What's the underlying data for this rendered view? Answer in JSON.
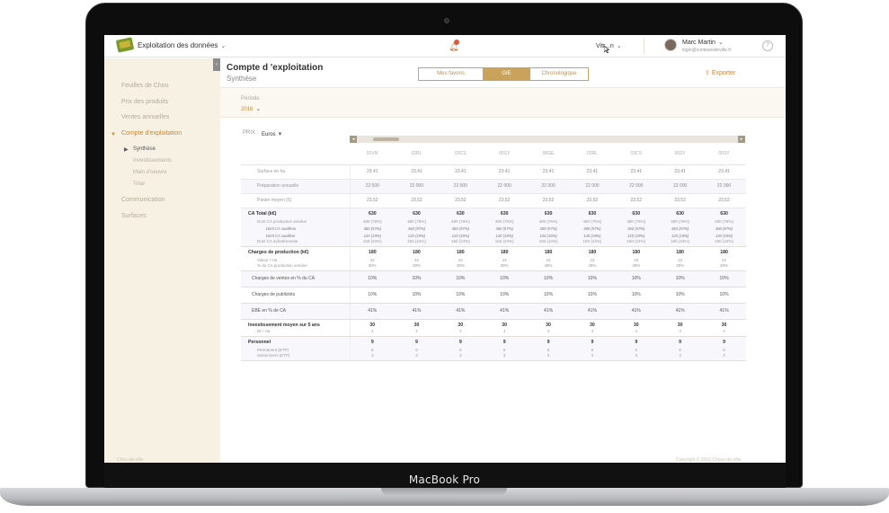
{
  "device": {
    "brand_label": "MacBook Pro"
  },
  "topbar": {
    "app_title": "Exploitation des données",
    "farm_name": "Vitr...n",
    "user_name": "Marc Martin",
    "user_email": "login@cuntesexdeville.fr",
    "help_glyph": "?"
  },
  "sidebar": {
    "items": [
      {
        "label": "Feuilles de Chou"
      },
      {
        "label": "Prix des produits"
      },
      {
        "label": "Ventes annuelles"
      },
      {
        "label": "Compte d'exploitation"
      },
      {
        "label": "Communication"
      },
      {
        "label": "Surfaces"
      }
    ],
    "sub_items": [
      {
        "label": "Synthèse"
      },
      {
        "label": "Investissements"
      },
      {
        "label": "Main d'oeuvre"
      },
      {
        "label": "Total"
      }
    ],
    "footer_left": "Chou-de-ville",
    "footer_right": "Copyright © 2016 Choux-de-ville"
  },
  "header": {
    "title": "Compte d 'exploitation",
    "subtitle": "Synthèse",
    "tabs": [
      {
        "label": "Mes favoris"
      },
      {
        "label": "GIE"
      },
      {
        "label": "Chronologique"
      }
    ],
    "export_label": "Exporter",
    "period_label": "Période",
    "period_value": "2016"
  },
  "price": {
    "label": "PRIX :",
    "value": "Euros"
  },
  "table": {
    "columns": [
      "01VN",
      "02RL",
      "03CS",
      "05SY",
      "06GE",
      "02RL",
      "03CS",
      "05SY",
      "05SY"
    ],
    "rows": {
      "surface": {
        "label": "Surface en ha",
        "value": "23,41"
      },
      "prep": {
        "label": "Préparation annuelle",
        "value": "22 000"
      },
      "panier": {
        "label": "Panier moyen (€)",
        "value": "23,52"
      },
      "ca_total": {
        "label": "CA Total (k€)",
        "value": "630"
      },
      "ca_prod": {
        "label": "Dont CA production vendue",
        "value": "480 (76%)"
      },
      "ca_cueil": {
        "label": "Dont CA cueillese",
        "value": "360 (57%)"
      },
      "ca_cueil2": {
        "label": "Dont CA cueilleur",
        "value": "120 (19%)"
      },
      "ca_achat": {
        "label": "Dont CA achat/revente",
        "value": "150 (24%)"
      },
      "charges": {
        "label": "Charges de production (k€)",
        "value": "180"
      },
      "valeur": {
        "label": "Valeur / Ha",
        "value": "22"
      },
      "pct_ca": {
        "label": "% du CA production vendue",
        "value": "39%"
      },
      "ventes": {
        "label": "Charges de ventes en % du CA",
        "value": "10%"
      },
      "pub": {
        "label": "Charges de publicités",
        "value": "10%"
      },
      "ebe": {
        "label": "EBE en % de CA",
        "value": "41%"
      },
      "invest": {
        "label": "Investissement moyen sur 5 ans",
        "value": "30"
      },
      "invest_ha": {
        "label": "k€ / Ha",
        "value": "4"
      },
      "personnel": {
        "label": "Personnel",
        "value": "9"
      },
      "permanent": {
        "label": "Permanent (ETP)",
        "value": "6"
      },
      "saisonnier": {
        "label": "Saisonniers (ETP)",
        "value": "3"
      }
    }
  }
}
